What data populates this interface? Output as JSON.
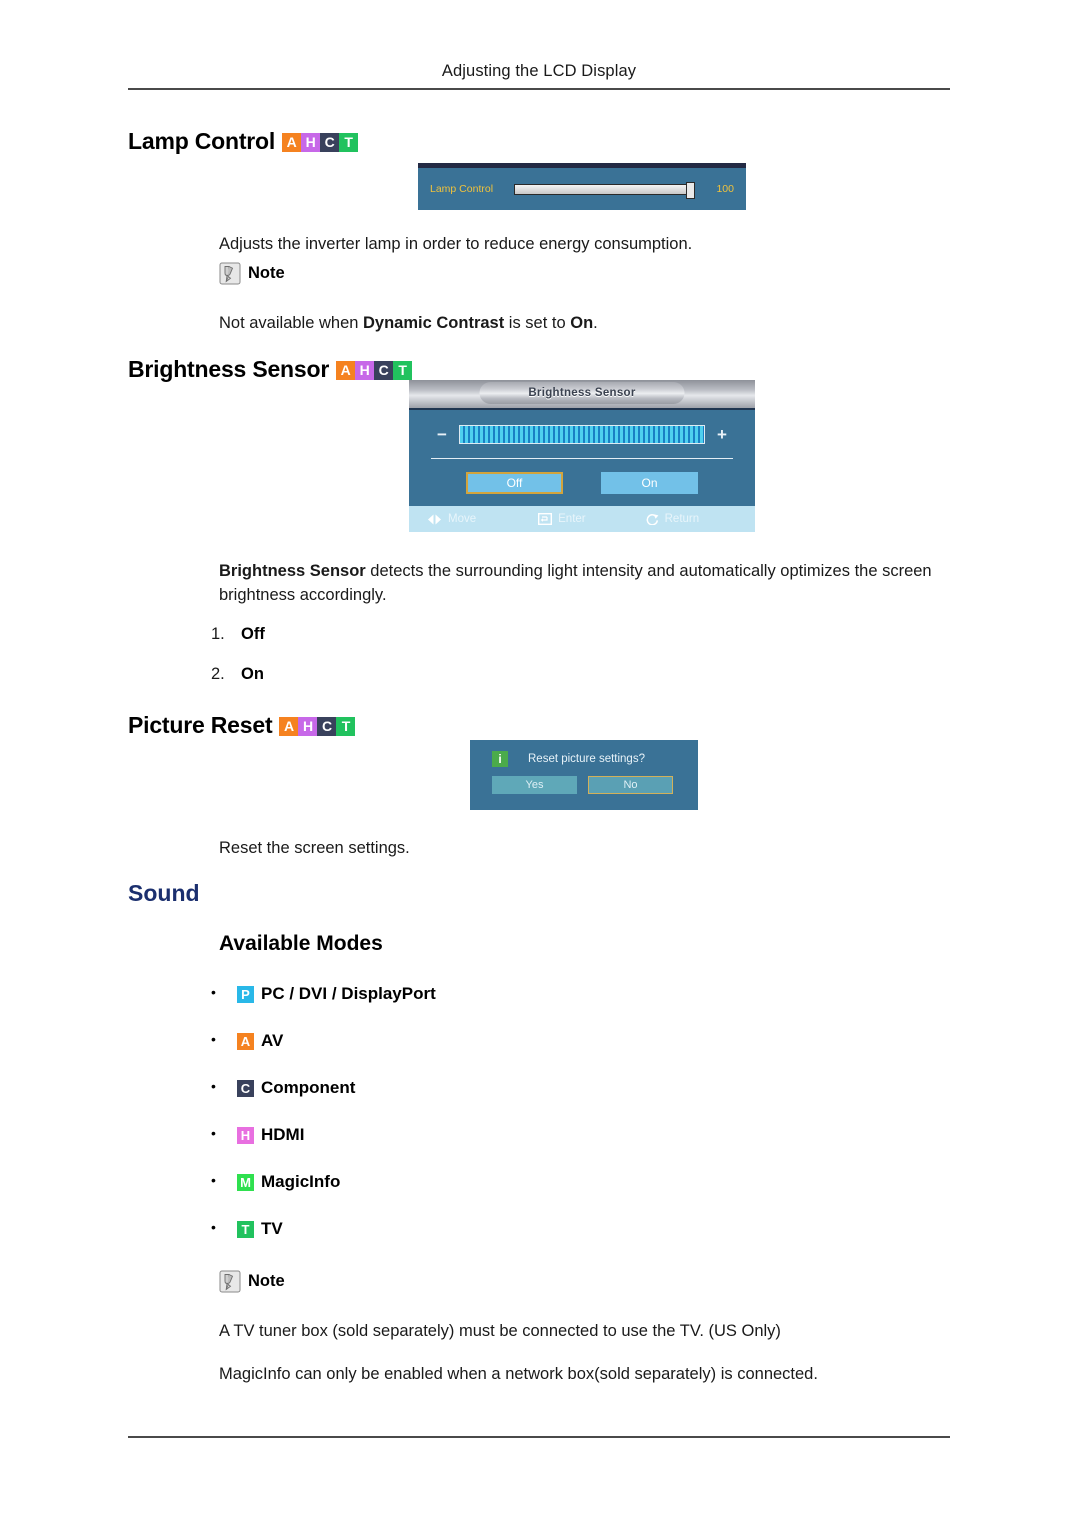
{
  "header": {
    "title": "Adjusting the LCD Display"
  },
  "badge_colors": {
    "A": "#f58220",
    "H": "#c768e8",
    "C": "#39415c",
    "T": "#21c25e",
    "P": "#29b8e8",
    "H_modes": "#e86fe0",
    "M": "#2fe04f"
  },
  "sections": {
    "lamp_control": {
      "heading": "Lamp Control",
      "badges": [
        "A",
        "H",
        "C",
        "T"
      ],
      "osd": {
        "label": "Lamp Control",
        "value": "100"
      },
      "description": "Adjusts the inverter lamp in order to reduce energy consumption.",
      "note_label": "Note",
      "note_text_parts": {
        "pre": "Not available when ",
        "bold1": "Dynamic Contrast",
        "mid": " is set to ",
        "bold2": "On",
        "post": "."
      }
    },
    "brightness_sensor": {
      "heading": "Brightness Sensor",
      "badges": [
        "A",
        "H",
        "C",
        "T"
      ],
      "osd": {
        "title": "Brightness Sensor",
        "minus": "−",
        "plus": "+",
        "buttons": [
          {
            "label": "Off",
            "selected": true
          },
          {
            "label": "On",
            "selected": false
          }
        ],
        "bottom_bar": [
          {
            "label": "Move",
            "icon": "move-arrows-icon"
          },
          {
            "label": "Enter",
            "icon": "enter-key-icon"
          },
          {
            "label": "Return",
            "icon": "return-arrow-icon"
          }
        ]
      },
      "description_parts": {
        "bold1": "Brightness Sensor",
        "rest": " detects the surrounding light intensity and automatically optimizes the screen brightness accordingly."
      },
      "list": [
        {
          "num": "1.",
          "text": "Off"
        },
        {
          "num": "2.",
          "text": "On"
        }
      ]
    },
    "picture_reset": {
      "heading": "Picture Reset",
      "badges": [
        "A",
        "H",
        "C",
        "T"
      ],
      "osd": {
        "prompt": "Reset picture settings?",
        "icon": "info-icon",
        "icon_glyph": "i",
        "buttons": [
          {
            "label": "Yes",
            "selected": false
          },
          {
            "label": "No",
            "selected": true
          }
        ]
      },
      "description": "Reset the screen settings."
    },
    "sound": {
      "heading": "Sound",
      "subheading": "Available Modes",
      "modes": [
        {
          "badge": "P",
          "badge_color": "#29b8e8",
          "label": "PC / DVI / DisplayPort"
        },
        {
          "badge": "A",
          "badge_color": "#f58220",
          "label": "AV"
        },
        {
          "badge": "C",
          "badge_color": "#39415c",
          "label": "Component"
        },
        {
          "badge": "H",
          "badge_color": "#e86fe0",
          "label": "HDMI"
        },
        {
          "badge": "M",
          "badge_color": "#2fe04f",
          "label": "MagicInfo"
        },
        {
          "badge": "T",
          "badge_color": "#21c25e",
          "label": "TV"
        }
      ],
      "note_label": "Note",
      "note_lines": [
        "A TV tuner box (sold separately) must be connected to use the TV. (US Only)",
        "MagicInfo can only be enabled when a network box(sold separately) is connected."
      ]
    }
  }
}
